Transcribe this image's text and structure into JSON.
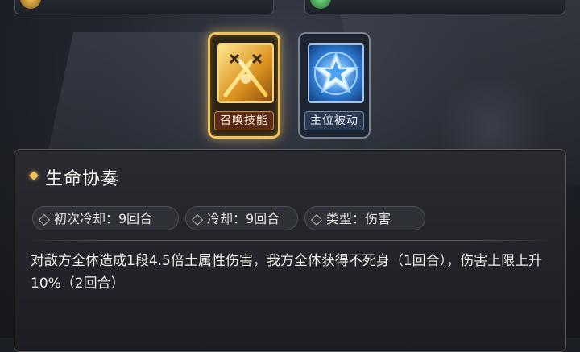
{
  "skills": [
    {
      "label": "召唤技能",
      "icon": "crossed-swords-icon",
      "selected": true
    },
    {
      "label": "主位被动",
      "icon": "star-icon",
      "selected": false
    }
  ],
  "skill_detail": {
    "name": "生命协奏",
    "tags": [
      {
        "text": "初次冷却：9回合"
      },
      {
        "text": "冷却：9回合"
      },
      {
        "text": "类型：伤害"
      }
    ],
    "description": "对敌方全体造成1段4.5倍土属性伤害，我方全体获得不死身（1回合），伤害上限上升10%（2回合）"
  },
  "colors": {
    "selected_border": "#f1c35a",
    "panel_bg": "#1d1e23"
  }
}
